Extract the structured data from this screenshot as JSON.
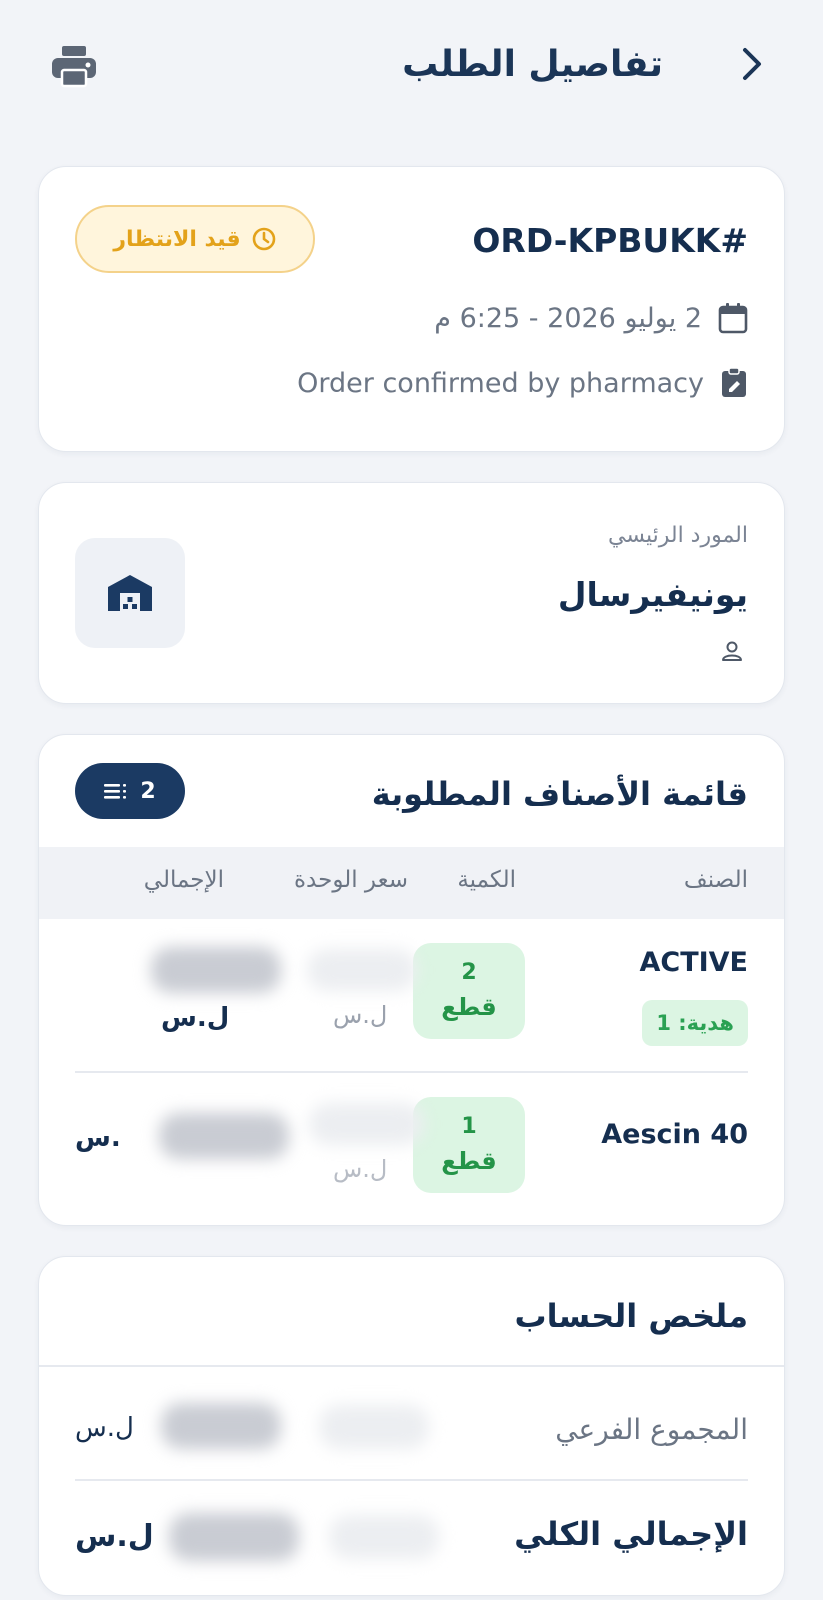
{
  "header": {
    "title": "تفاصيل الطلب"
  },
  "order": {
    "id": "ORD-KPBUKK#",
    "status": "قيد الانتظار",
    "status_color": "#e3a21a",
    "date": "2 يوليو 2026 - 6:25 م",
    "note": "Order confirmed by pharmacy"
  },
  "supplier": {
    "label": "المورد الرئيسي",
    "name": "يونيفيرسال"
  },
  "items": {
    "title": "قائمة الأصناف المطلوبة",
    "count": "2",
    "columns": {
      "name": "الصنف",
      "qty": "الكمية",
      "unit_price": "سعر الوحدة",
      "total": "الإجمالي"
    },
    "rows": [
      {
        "name": "ACTIVE",
        "gift": "هدية: 1",
        "qty": "2",
        "unit": "قطع",
        "unit_currency": "ل.س",
        "total_currency": "ل.س"
      },
      {
        "name": "Aescin 40",
        "qty": "1",
        "unit": "قطع",
        "unit_currency": "ل.س",
        "total_currency": ".س"
      }
    ]
  },
  "summary": {
    "title": "ملخص الحساب",
    "subtotal_label": "المجموع الفرعي",
    "subtotal_currency": "ل.س",
    "grand_label": "الإجمالي الكلي",
    "grand_currency": "ل.س"
  },
  "colors": {
    "primary": "#1b3a63",
    "success": "#249448",
    "warning": "#e3a21a"
  }
}
